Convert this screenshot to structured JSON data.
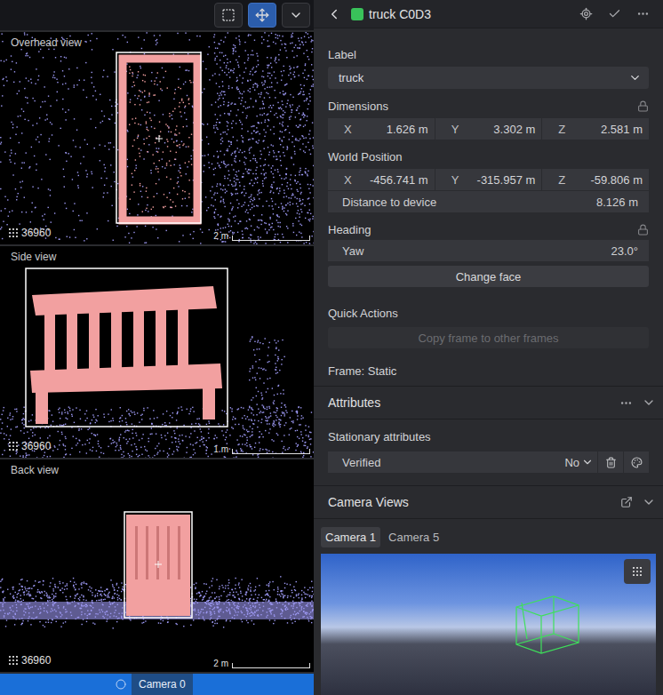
{
  "toolbar": {
    "buttons": [
      {
        "kind": "select",
        "selected": false
      },
      {
        "kind": "move",
        "selected": true
      },
      {
        "kind": "menu",
        "selected": false
      }
    ]
  },
  "views": [
    {
      "kind": "overhead",
      "title": "Overhead view",
      "point_count": "36960",
      "scale": "2 m"
    },
    {
      "kind": "side",
      "title": "Side view",
      "point_count": "36960",
      "scale": "1 m"
    },
    {
      "kind": "back",
      "title": "Back view",
      "point_count": "36960",
      "scale": "2 m"
    }
  ],
  "camera_strip": {
    "tabs": [
      {
        "label": "Camera 0",
        "selected": true
      }
    ]
  },
  "object": {
    "name": "truck C0D3"
  },
  "label": {
    "title": "Label",
    "value": "truck"
  },
  "dimensions": {
    "title": "Dimensions",
    "locked": true,
    "fields": [
      {
        "axis": "X",
        "value": "1.626 m"
      },
      {
        "axis": "Y",
        "value": "3.302 m"
      },
      {
        "axis": "Z",
        "value": "2.581 m"
      }
    ]
  },
  "world_position": {
    "title": "World Position",
    "fields": [
      {
        "axis": "X",
        "value": "-456.741 m"
      },
      {
        "axis": "Y",
        "value": "-315.957 m"
      },
      {
        "axis": "Z",
        "value": "-59.806 m"
      }
    ],
    "distance": {
      "label": "Distance to device",
      "value": "8.126 m"
    }
  },
  "heading": {
    "title": "Heading",
    "locked": true,
    "yaw": {
      "label": "Yaw",
      "value": "23.0°"
    },
    "change_face": "Change face"
  },
  "quick_actions": {
    "title": "Quick Actions",
    "copy": {
      "label": "Copy frame to other frames",
      "disabled": true
    }
  },
  "frame": "Frame: Static",
  "attributes": {
    "title": "Attributes",
    "expanded": true,
    "section": "Stationary attributes",
    "items": [
      {
        "name": "Verified",
        "value": "No"
      }
    ]
  },
  "camera_views": {
    "title": "Camera Views",
    "expanded": true,
    "tabs": [
      {
        "label": "Camera 1",
        "selected": true
      },
      {
        "label": "Camera 5",
        "selected": false
      }
    ]
  }
}
